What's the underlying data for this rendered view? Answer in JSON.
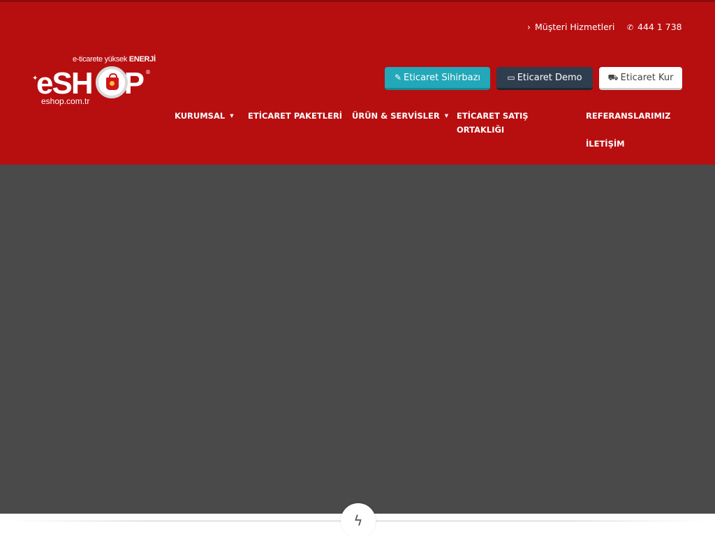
{
  "logo": {
    "tagline_prefix": "e-ticarete yüksek",
    "tagline_strong": "ENERJİ",
    "wordmark_left": "eSH",
    "wordmark_right": "P",
    "registered": "®",
    "site": "eshop.com.tr",
    "icon": "shopping-bag-icon"
  },
  "topbar": {
    "customer_service": "Müşteri Hizmetleri",
    "customer_icon": "chevron-right-icon",
    "phone": "444 1 738",
    "phone_icon": "phone-icon"
  },
  "buttons": {
    "wizard": {
      "label": "Eticaret Sihirbazı",
      "icon": "magic-wand-icon",
      "color": "#22a8b8"
    },
    "demo": {
      "label": "Eticaret Demo",
      "icon": "monitor-icon",
      "color": "#2e3e4e"
    },
    "install": {
      "label": "Eticaret Kur",
      "icon": "cart-icon",
      "color": "#ffffff"
    }
  },
  "nav": {
    "kurumsal": "KURUMSAL",
    "paketler": "ETİCARET PAKETLERİ",
    "urun": "ÜRÜN & SERVİSLER",
    "satis": "ETİCARET SATIŞ ORTAKLIĞI",
    "referans": "REFERANSLARIMIZ",
    "iletisim": "İLETİŞİM"
  },
  "divider": {
    "icon": "lightning-bolt-icon"
  },
  "colors": {
    "header_bg": "#b70e10",
    "slider_bg": "#4a4a4a"
  }
}
